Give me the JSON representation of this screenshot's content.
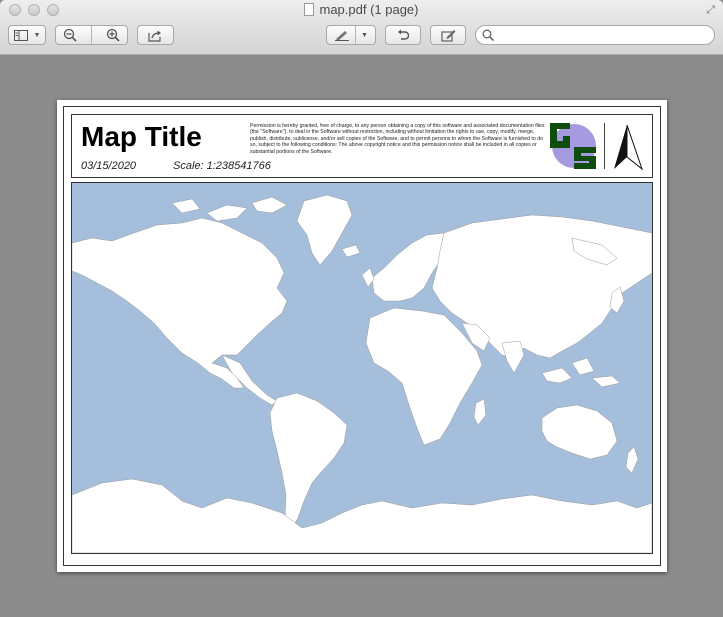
{
  "window": {
    "title": "map.pdf (1 page)"
  },
  "toolbar": {
    "sidebar_icon": "sidebar-icon",
    "zoom_out_icon": "zoom-out-icon",
    "zoom_in_icon": "zoom-in-icon",
    "share_icon": "share-icon",
    "markup_icon": "pen-icon",
    "rotate_icon": "rotate-icon",
    "edit_icon": "edit-icon",
    "search_icon": "search-icon",
    "search_value": ""
  },
  "document": {
    "title": "Map Title",
    "date": "03/15/2020",
    "scale": "Scale: 1:238541766",
    "license": "Permission is hereby granted, free of charge, to any person obtaining a copy of this software and associated documentation files (the \"Software\"), to deal in the Software without restriction, including without limitation the rights to use, copy, modify, merge, publish, distribute, sublicense, and/or sell copies of the Software, and to permit persons to whom the Software is furnished to do so, subject to the following conditions: The above copyright notice and this permission notice shall be included in all copies or substantial portions of the Software.",
    "logo_name": "gs-logo",
    "north_arrow_name": "north-arrow-icon"
  },
  "colors": {
    "ocean": "#a5bedb",
    "land": "#ffffff",
    "logo_green": "#0f4d0f",
    "logo_purple": "#a59ae0"
  }
}
